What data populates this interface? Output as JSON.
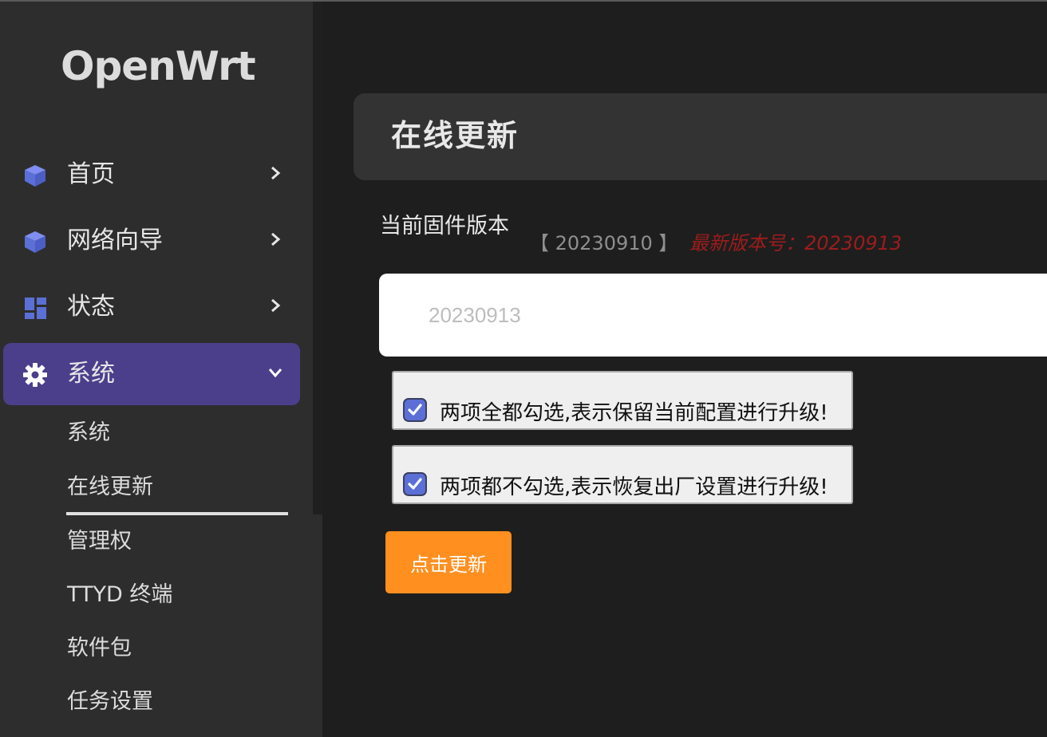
{
  "sidebar": {
    "logo": "OpenWrt",
    "items": [
      {
        "label": "首页",
        "icon": "cube-icon"
      },
      {
        "label": "网络向导",
        "icon": "cube-icon"
      },
      {
        "label": "状态",
        "icon": "dashboard-icon"
      },
      {
        "label": "系统",
        "icon": "gear-icon"
      }
    ],
    "subitems": [
      {
        "label": "系统"
      },
      {
        "label": "在线更新"
      },
      {
        "label": "管理权"
      },
      {
        "label": "TTYD 终端"
      },
      {
        "label": "软件包"
      },
      {
        "label": "任务设置"
      }
    ]
  },
  "main": {
    "title": "在线更新",
    "firmware_label": "当前固件版本",
    "current_version": "【 20230910 】",
    "latest_version": "最新版本号：20230913",
    "version_input_placeholder": "20230913",
    "options": [
      {
        "label": "两项全都勾选,表示保留当前配置进行升级!",
        "checked": true
      },
      {
        "label": "两项都不勾选,表示恢复出厂设置进行升级!",
        "checked": true
      }
    ],
    "update_button": "点击更新"
  },
  "colors": {
    "accent": "#5b6fd6",
    "active_nav": "#4b3f8c",
    "button": "#ff8f1f",
    "latest_version": "#9d1c1c"
  }
}
